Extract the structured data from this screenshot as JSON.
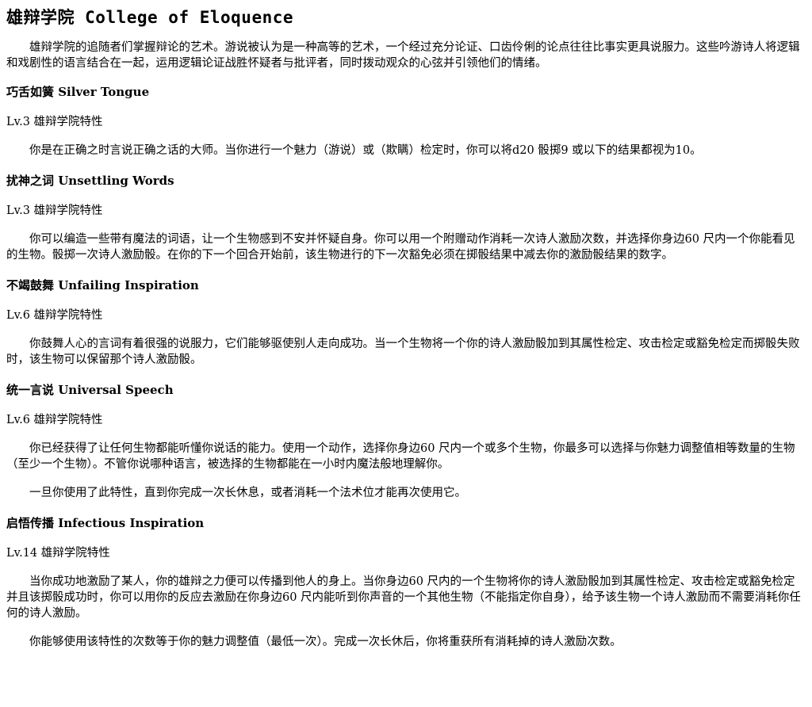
{
  "page_title": {
    "cn": "雄辩学院",
    "en": "College of Eloquence"
  },
  "intro": "雄辩学院的追随者们掌握辩论的艺术。游说被认为是一种高等的艺术，一个经过充分论证、口齿伶俐的论点往往比事实更具说服力。这些吟游诗人将逻辑和戏剧性的语言结合在一起，运用逻辑论证战胜怀疑者与批评者，同时拨动观众的心弦并引领他们的情绪。",
  "features": [
    {
      "title": "巧舌如簧 Silver Tongue",
      "level": "Lv.3 雄辩学院特性",
      "paragraphs": [
        "你是在正确之时言说正确之话的大师。当你进行一个魅力（游说）或（欺瞒）检定时，你可以将d20 骰掷9 或以下的结果都视为10。"
      ]
    },
    {
      "title": "扰神之词 Unsettling Words",
      "level": "Lv.3 雄辩学院特性",
      "paragraphs": [
        "你可以编造一些带有魔法的词语，让一个生物感到不安并怀疑自身。你可以用一个附赠动作消耗一次诗人激励次数，并选择你身边60 尺内一个你能看见的生物。骰掷一次诗人激励骰。在你的下一个回合开始前，该生物进行的下一次豁免必须在掷骰结果中减去你的激励骰结果的数字。"
      ]
    },
    {
      "title": "不竭鼓舞 Unfailing Inspiration",
      "level": "Lv.6 雄辩学院特性",
      "paragraphs": [
        "你鼓舞人心的言词有着很强的说服力，它们能够驱使别人走向成功。当一个生物将一个你的诗人激励骰加到其属性检定、攻击检定或豁免检定而掷骰失败时，该生物可以保留那个诗人激励骰。"
      ]
    },
    {
      "title": "统一言说 Universal Speech",
      "level": "Lv.6 雄辩学院特性",
      "paragraphs": [
        "你已经获得了让任何生物都能听懂你说话的能力。使用一个动作，选择你身边60 尺内一个或多个生物，你最多可以选择与你魅力调整值相等数量的生物（至少一个生物）。不管你说哪种语言，被选择的生物都能在一小时内魔法般地理解你。",
        "一旦你使用了此特性，直到你完成一次长休息，或者消耗一个法术位才能再次使用它。"
      ]
    },
    {
      "title": "启悟传播 Infectious Inspiration",
      "level": "Lv.14 雄辩学院特性",
      "paragraphs": [
        "当你成功地激励了某人，你的雄辩之力便可以传播到他人的身上。当你身边60 尺内的一个生物将你的诗人激励骰加到其属性检定、攻击检定或豁免检定并且该掷骰成功时，你可以用你的反应去激励在你身边60 尺内能听到你声音的一个其他生物（不能指定你自身），给予该生物一个诗人激励而不需要消耗你任何的诗人激励。",
        "你能够使用该特性的次数等于你的魅力调整值（最低一次）。完成一次长休后，你将重获所有消耗掉的诗人激励次数。"
      ]
    }
  ]
}
